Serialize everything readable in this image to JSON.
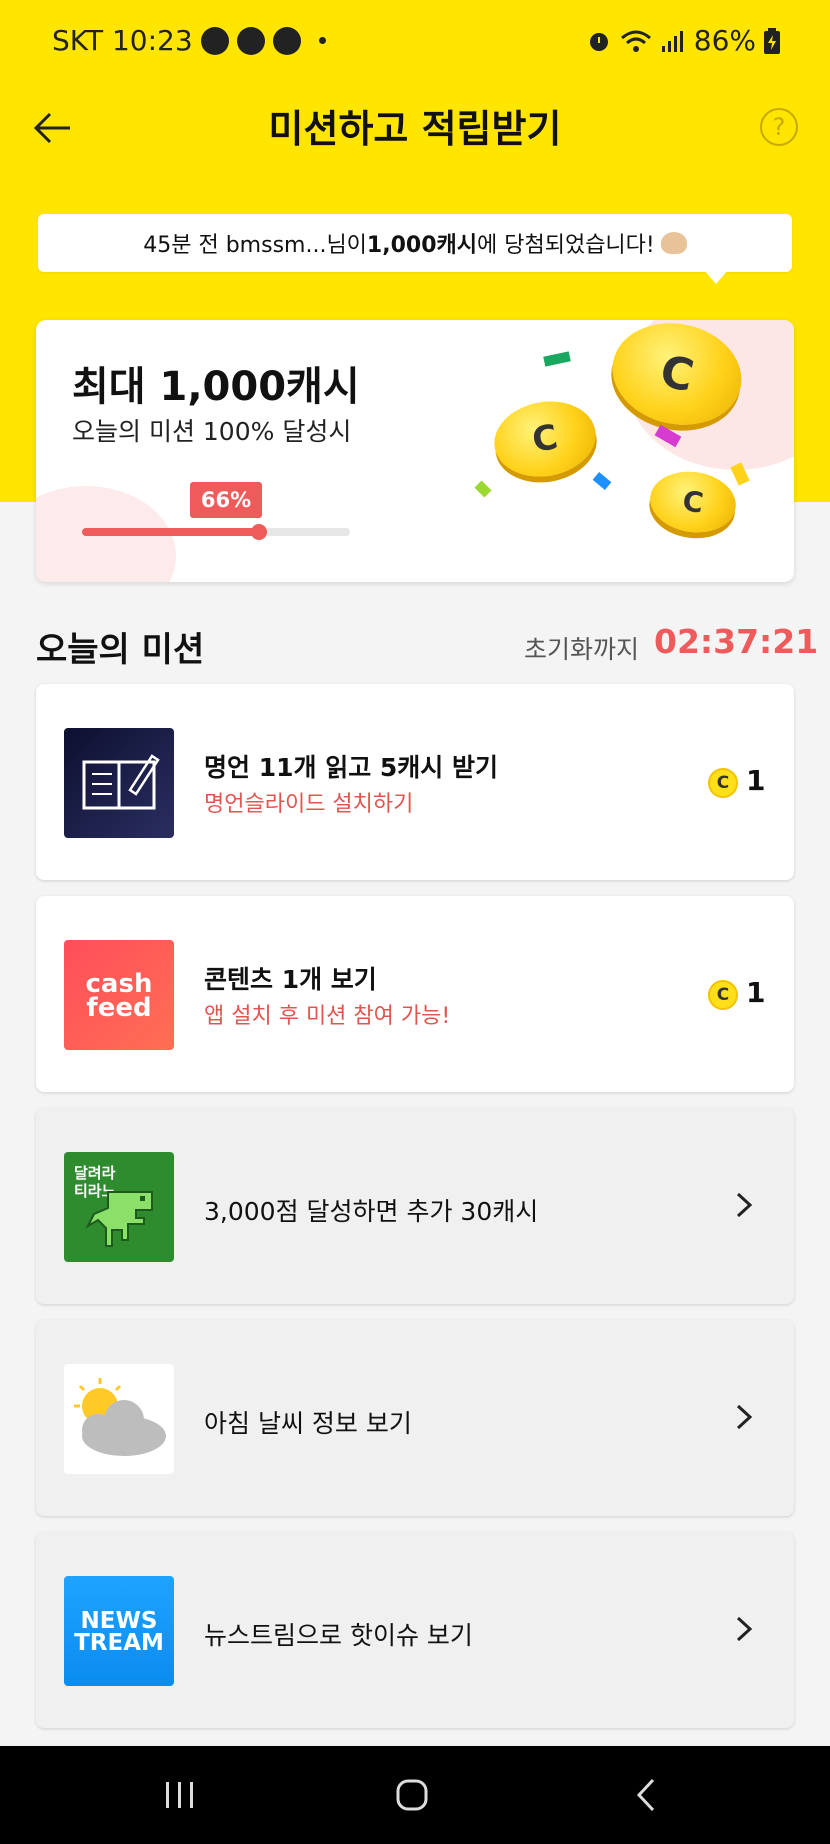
{
  "status_bar": {
    "carrier_time": "SKT 10:23",
    "battery": "86%",
    "icons": [
      "talk-icon",
      "radiation-icon",
      "bike-icon",
      "alarm-icon",
      "wifi-icon",
      "signal-icon",
      "battery-icon"
    ]
  },
  "header": {
    "title": "미션하고 적립받기",
    "help_icon": "?"
  },
  "notice": {
    "prefix": "45분 전 bmssm...님이 ",
    "highlight": "1,000캐시",
    "suffix": "에 당첨되었습니다!"
  },
  "reward_card": {
    "title": "최대 1,000캐시",
    "subtitle": "오늘의 미션 100% 달성시",
    "progress_label": "66%",
    "progress": 0.66
  },
  "missions_section": {
    "title": "오늘의 미션",
    "reset_label": "초기화까지",
    "reset_time": "02:37:21"
  },
  "missions": [
    {
      "title": "명언 11개 읽고 5캐시 받기",
      "subtitle": "명언슬라이드 설치하기",
      "coin_symbol": "C",
      "reward": "1",
      "icon": "book-pen-icon"
    },
    {
      "title": "콘텐츠 1개 보기",
      "subtitle": "앱 설치 후 미션 참여 가능!",
      "coin_symbol": "C",
      "reward": "1",
      "icon": "cashfeed-logo",
      "icon_text_1": "cash",
      "icon_text_2": "feed"
    },
    {
      "text": "3,000점 달성하면 추가 30캐시",
      "icon": "dinosaur-game-icon",
      "icon_text_1": "달려라",
      "icon_text_2": "티라노"
    },
    {
      "text": "아침 날씨 정보 보기",
      "icon": "weather-icon"
    },
    {
      "text": "뉴스트림으로 핫이슈 보기",
      "icon": "newstream-logo",
      "icon_text_1": "NEWS",
      "icon_text_2": "TREAM"
    }
  ],
  "colors": {
    "header_yellow": "#ffe500",
    "accent_red": "#ef5b5b",
    "coin_yellow": "#ffd21a"
  }
}
